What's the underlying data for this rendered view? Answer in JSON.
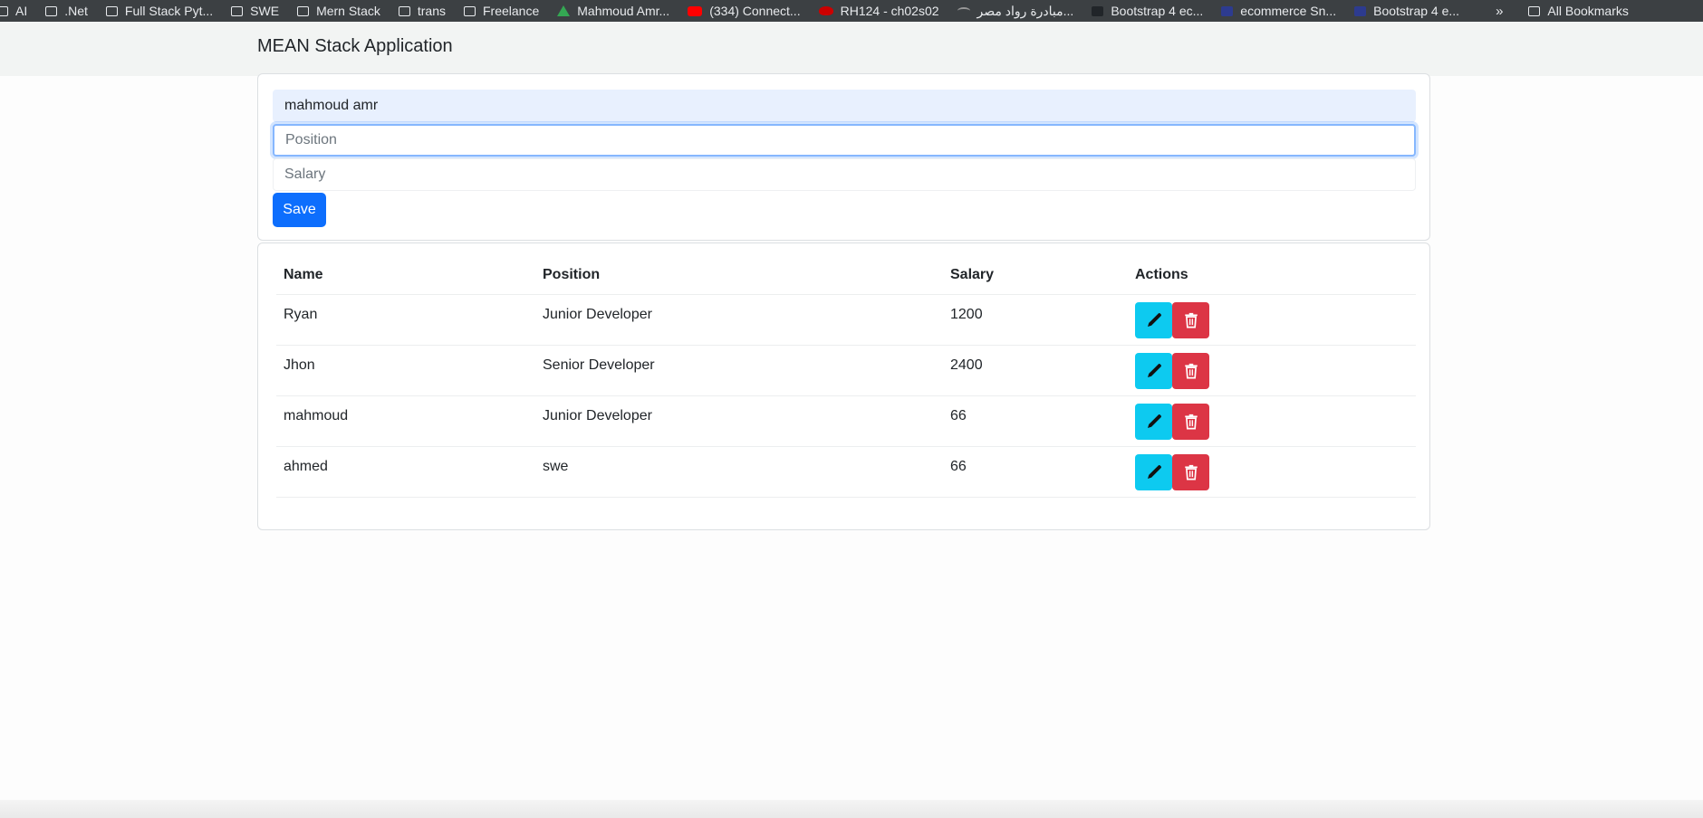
{
  "bookmarks": [
    {
      "label": "AI",
      "icon": "folder-icon"
    },
    {
      "label": ".Net",
      "icon": "folder-icon"
    },
    {
      "label": "Full Stack Pyt...",
      "icon": "folder-icon"
    },
    {
      "label": "SWE",
      "icon": "folder-icon"
    },
    {
      "label": "Mern Stack",
      "icon": "folder-icon"
    },
    {
      "label": "trans",
      "icon": "folder-icon"
    },
    {
      "label": "Freelance",
      "icon": "folder-icon"
    },
    {
      "label": "Mahmoud Amr...",
      "icon": "drive-icon"
    },
    {
      "label": "(334) Connect...",
      "icon": "youtube-icon"
    },
    {
      "label": "RH124 - ch02s02",
      "icon": "redhat-icon"
    },
    {
      "label": "مبادرة رواد مصر...",
      "icon": "site-icon"
    },
    {
      "label": "Bootstrap 4 ec...",
      "icon": "bootstrap-icon"
    },
    {
      "label": "ecommerce Sn...",
      "icon": "snippet-icon"
    },
    {
      "label": "Bootstrap 4 e...",
      "icon": "snippet-icon"
    }
  ],
  "bookmarks_overflow": "»",
  "all_bookmarks": "All Bookmarks",
  "app_title": "MEAN Stack Application",
  "form": {
    "name_value": "mahmoud amr",
    "position_value": "",
    "position_placeholder": "Position",
    "salary_value": "",
    "salary_placeholder": "Salary",
    "save_label": "Save"
  },
  "table": {
    "headers": [
      "Name",
      "Position",
      "Salary",
      "Actions"
    ],
    "rows": [
      {
        "name": "Ryan",
        "position": "Junior Developer",
        "salary": "1200"
      },
      {
        "name": "Jhon",
        "position": "Senior Developer",
        "salary": "2400"
      },
      {
        "name": "mahmoud",
        "position": "Junior Developer",
        "salary": "66"
      },
      {
        "name": "ahmed",
        "position": "swe",
        "salary": "66"
      }
    ],
    "edit_icon": "pencil-icon",
    "delete_icon": "trash-icon"
  },
  "colors": {
    "primary": "#0d6efd",
    "info": "#0dcaf0",
    "danger": "#dc3545",
    "autofill": "#e8f0fe"
  }
}
